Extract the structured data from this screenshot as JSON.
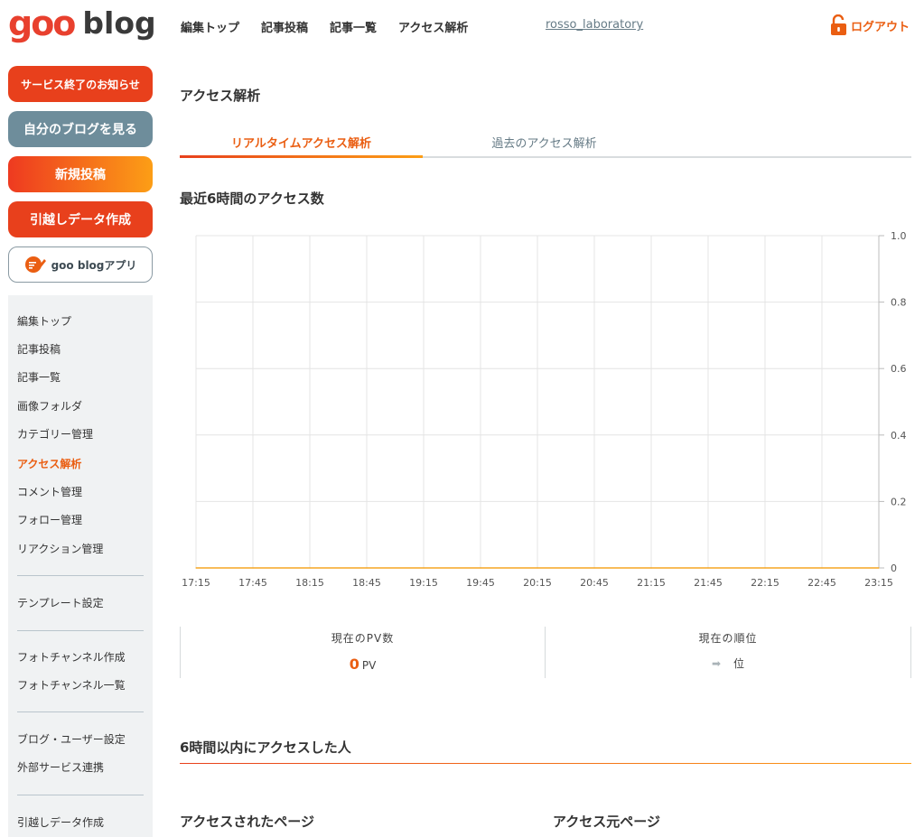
{
  "header": {
    "logo_goo": "goo",
    "logo_blog": "blog",
    "nav": [
      "編集トップ",
      "記事投稿",
      "記事一覧",
      "アクセス解析"
    ],
    "username": "rosso_laboratory",
    "logout_label": "ログアウト"
  },
  "sidebar": {
    "buttons": {
      "service_end": "サービス終了のお知らせ",
      "view_blog": "自分のブログを見る",
      "new_post": "新規投稿",
      "migration": "引越しデータ作成",
      "app": "goo blogアプリ"
    },
    "menu": [
      "編集トップ",
      "記事投稿",
      "記事一覧",
      "画像フォルダ",
      "カテゴリー管理",
      "アクセス解析",
      "コメント管理",
      "フォロー管理",
      "リアクション管理",
      "テンプレート設定",
      "フォトチャンネル作成",
      "フォトチャンネル一覧",
      "ブログ・ユーザー設定",
      "外部サービス連携",
      "引越しデータ作成"
    ],
    "active": "アクセス解析"
  },
  "main": {
    "title": "アクセス解析",
    "tabs": [
      "リアルタイムアクセス解析",
      "過去のアクセス解析"
    ],
    "chart_title": "最近6時間のアクセス数",
    "stats": {
      "pv_label": "現在のPV数",
      "pv_value": "0",
      "pv_unit": "PV",
      "rank_label": "現在の順位",
      "rank_arrow": "➡",
      "rank_unit": "位"
    },
    "section_visitors": "6時間以内にアクセスした人",
    "accessed_pages": "アクセスされたページ",
    "referrer_pages": "アクセス元ページ"
  },
  "colors": {
    "accent": "#ea5e12",
    "brand_red": "#e8401c",
    "gray_button": "#6e8d9b",
    "line": "#f5a623"
  },
  "chart_data": {
    "type": "line",
    "title": "最近6時間のアクセス数",
    "xlabel": "",
    "ylabel": "",
    "x": [
      "17:15",
      "17:45",
      "18:15",
      "18:45",
      "19:15",
      "19:45",
      "20:15",
      "20:45",
      "21:15",
      "21:45",
      "22:15",
      "22:45",
      "23:15"
    ],
    "series": [
      {
        "values": [
          0,
          0,
          0,
          0,
          0,
          0,
          0,
          0,
          0,
          0,
          0,
          0,
          0
        ]
      }
    ],
    "y_ticks": [
      "1.0",
      "0.8",
      "0.6",
      "0.4",
      "0.2",
      "0"
    ],
    "ylim": [
      0,
      1.0
    ],
    "y_axis_side": "right",
    "grid": true,
    "legend": "none"
  }
}
